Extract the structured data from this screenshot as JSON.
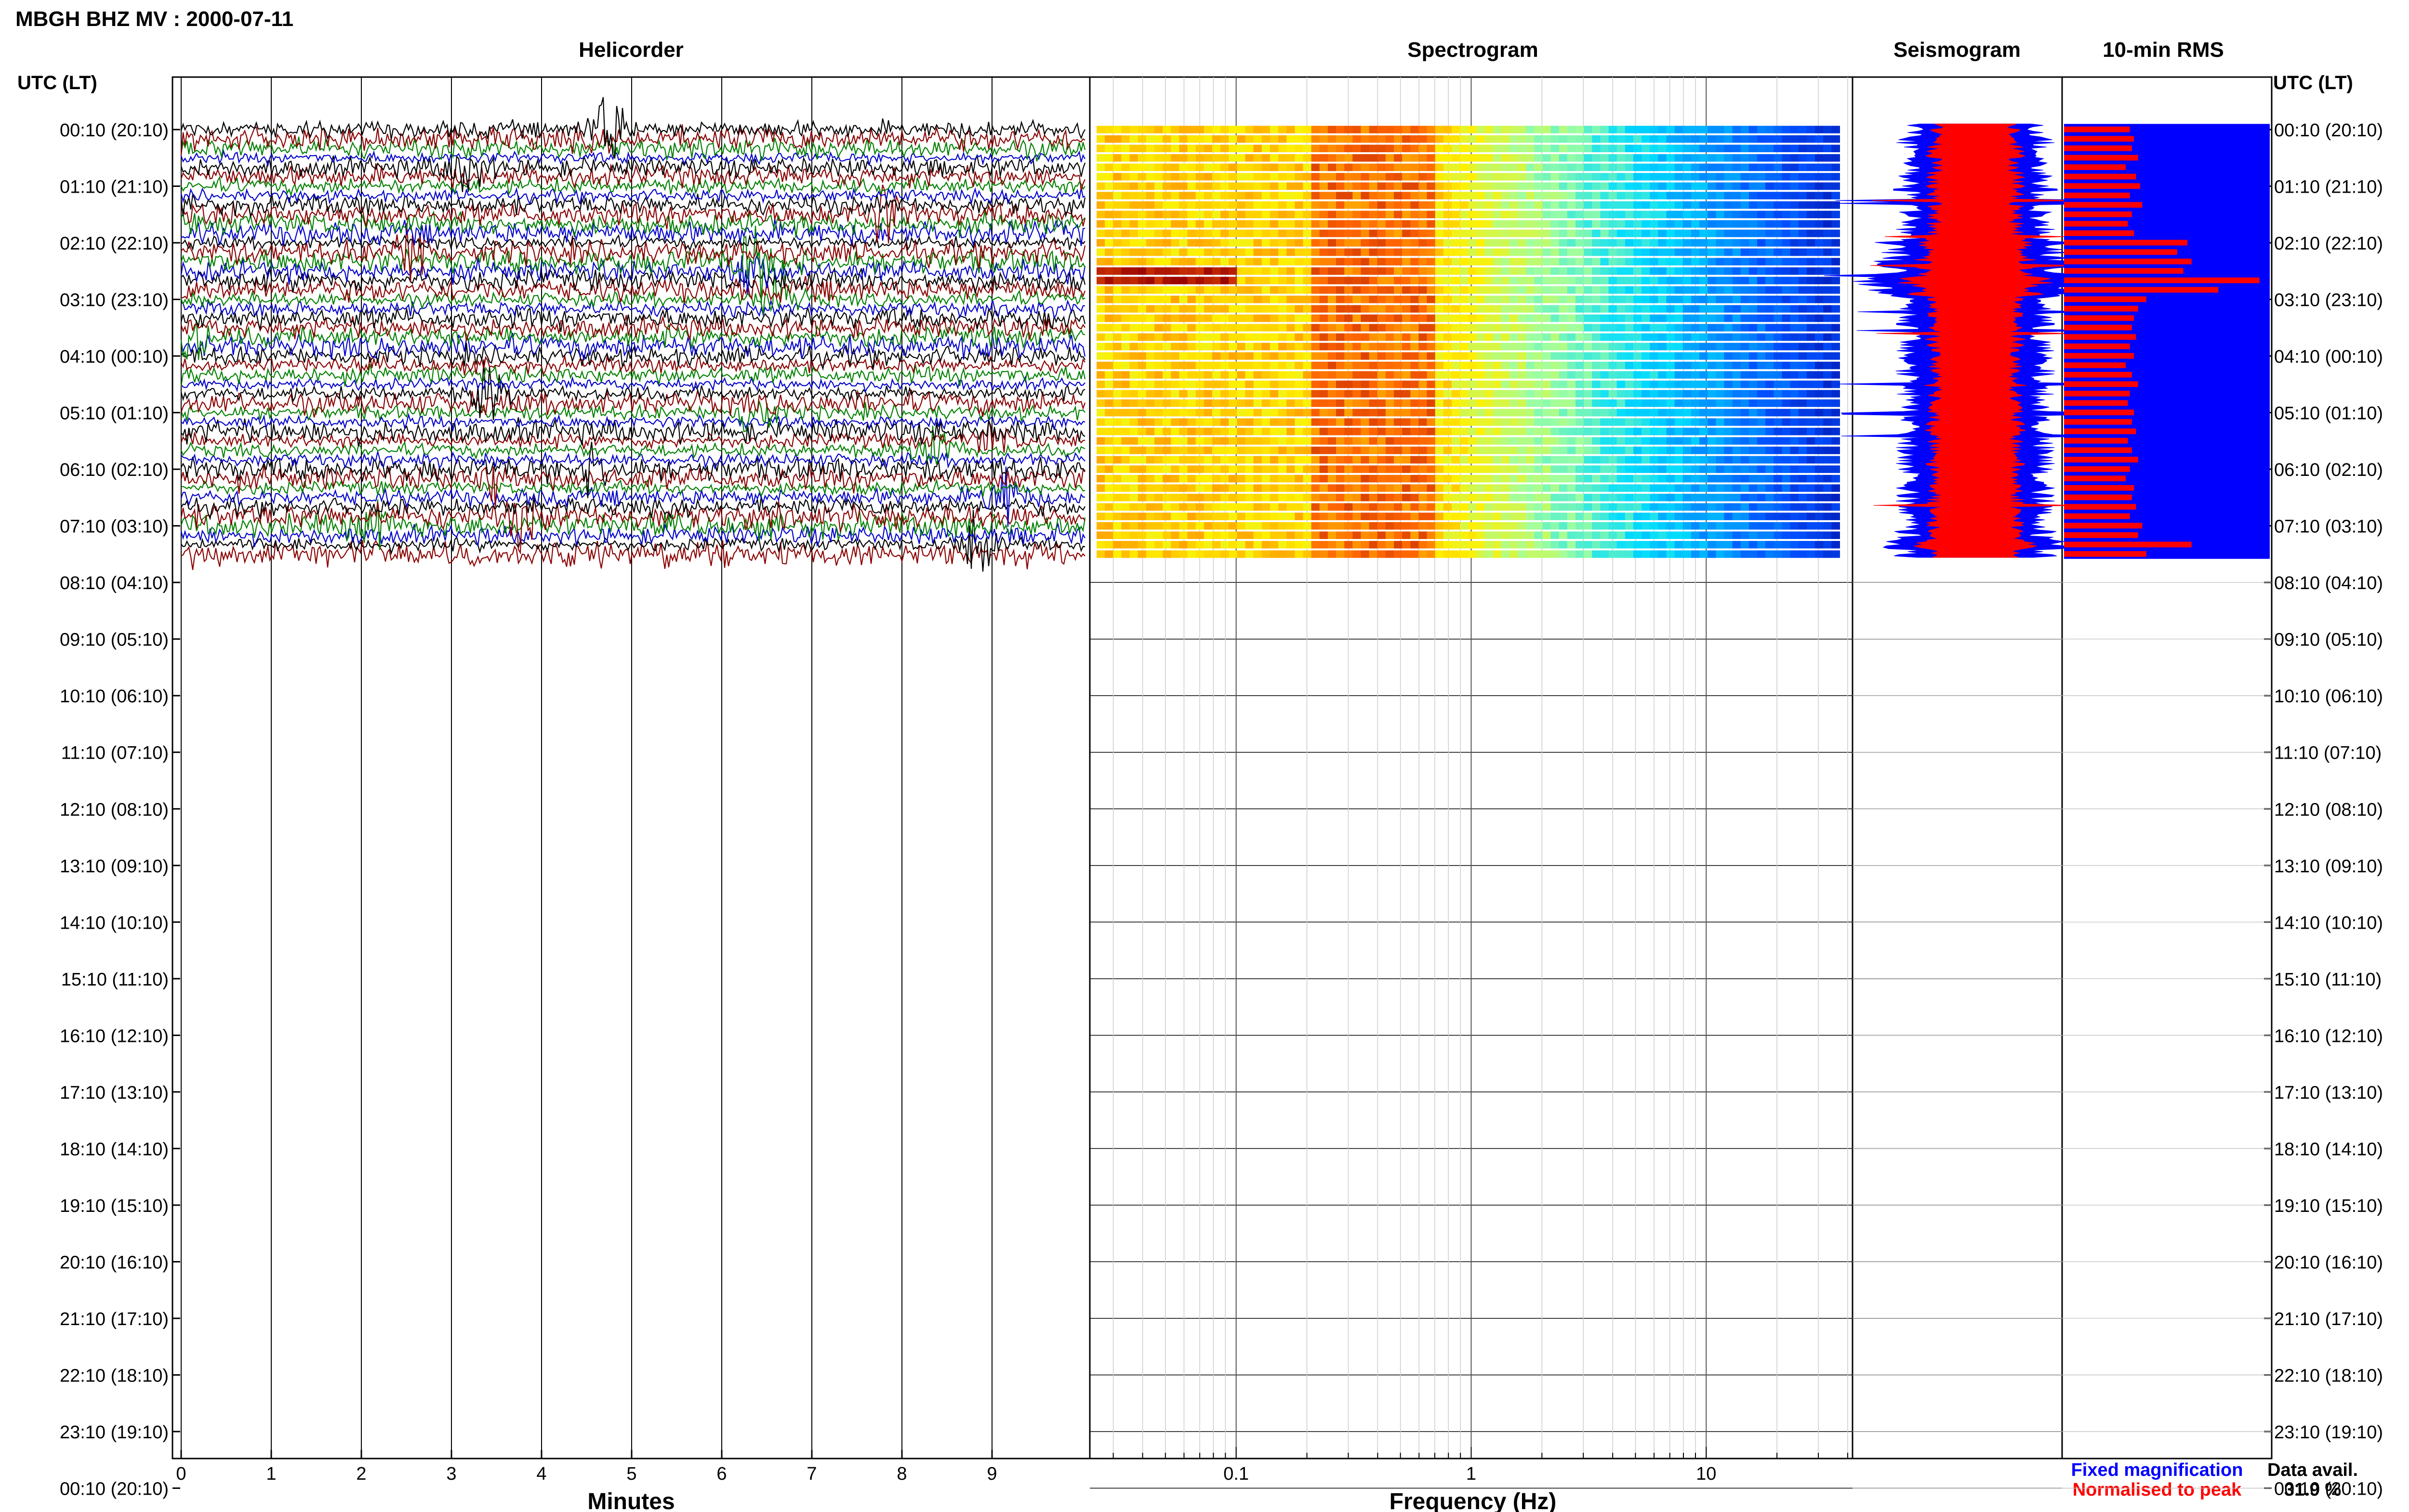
{
  "title": "MBGH BHZ MV : 2000-07-11",
  "panels": {
    "helicorder": "Helicorder",
    "spectrogram": "Spectrogram",
    "seismogram": "Seismogram",
    "rms": "10-min RMS"
  },
  "time_header": "UTC (LT)",
  "time_labels": [
    "00:10 (20:10)",
    "01:10 (21:10)",
    "02:10 (22:10)",
    "03:10 (23:10)",
    "04:10 (00:10)",
    "05:10 (01:10)",
    "06:10 (02:10)",
    "07:10 (03:10)",
    "08:10 (04:10)",
    "09:10 (05:10)",
    "10:10 (06:10)",
    "11:10 (07:10)",
    "12:10 (08:10)",
    "13:10 (09:10)",
    "14:10 (10:10)",
    "15:10 (11:10)",
    "16:10 (12:10)",
    "17:10 (13:10)",
    "18:10 (14:10)",
    "19:10 (15:10)",
    "20:10 (16:10)",
    "21:10 (17:10)",
    "22:10 (18:10)",
    "23:10 (19:10)",
    "00:10 (20:10)"
  ],
  "x_axis_label": "Minutes",
  "x_ticks": [
    "0",
    "1",
    "2",
    "3",
    "4",
    "5",
    "6",
    "7",
    "8",
    "9"
  ],
  "freq_axis_label": "Frequency (Hz)",
  "freq_ticks": [
    "0.1",
    "1",
    "10"
  ],
  "legend": {
    "fixed": "Fixed magnification",
    "normalised": "Normalised to peak",
    "fixed_color": "#0000ff",
    "normalised_color": "#ff0000"
  },
  "data_avail_label": "Data avail.",
  "data_avail_value": "31.9 %",
  "colors": {
    "trace_cycle": [
      "#000000",
      "#8b0000",
      "#008000",
      "#0000cc"
    ],
    "rms_bar": "#ff0000",
    "rms_background": "#0000ff"
  },
  "chart_data": {
    "type": "heatmap",
    "helicorder_minutes_range": [
      0,
      10
    ],
    "frequency_range_hz": [
      0.025,
      40
    ],
    "frequency_scale": "log",
    "rows_with_data": 46,
    "rows_total": 144,
    "data_availability_percent": 31.9,
    "rms_values": [
      0.32,
      0.34,
      0.33,
      0.36,
      0.3,
      0.35,
      0.37,
      0.32,
      0.38,
      0.33,
      0.31,
      0.34,
      0.6,
      0.55,
      0.62,
      0.58,
      0.95,
      0.75,
      0.4,
      0.36,
      0.34,
      0.33,
      0.35,
      0.32,
      0.34,
      0.3,
      0.33,
      0.36,
      0.32,
      0.31,
      0.34,
      0.33,
      0.35,
      0.31,
      0.33,
      0.36,
      0.32,
      0.3,
      0.34,
      0.33,
      0.35,
      0.32,
      0.38,
      0.36,
      0.62,
      0.4
    ]
  }
}
